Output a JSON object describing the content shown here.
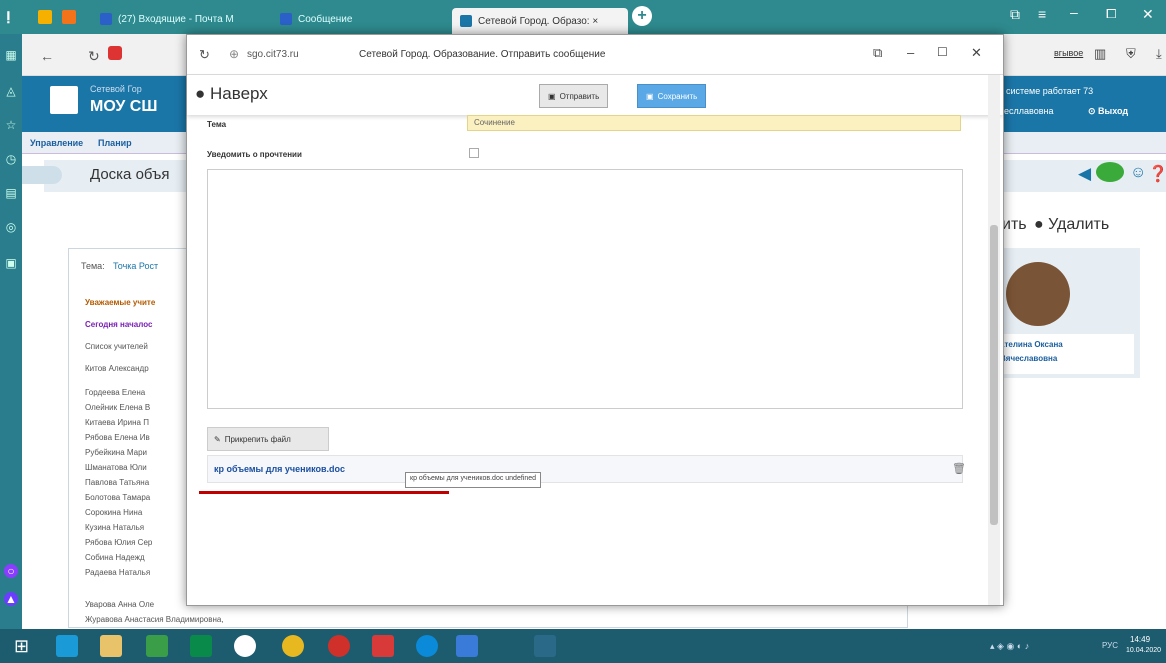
{
  "os_tabs": [
    {
      "label": "(27) Входящие - Почта M"
    },
    {
      "label": "Сообщение"
    },
    {
      "label": "Сетевой Город. Образо: ×"
    }
  ],
  "addressbar": {
    "url": "sgo.cit73.ru",
    "page_title": "Сетевой Город. Образование. Отправить сообщение",
    "right_text": "вгывое"
  },
  "site": {
    "brand_line1": "Сетевой Гор",
    "brand_line2": "МОУ СШ",
    "right_line1": "системе работает 73",
    "right_line2": "есллавовна",
    "logout": "Выход",
    "nav": [
      "Управление",
      "Планир"
    ],
    "board_title": "Доска объя",
    "delete_text": "ить",
    "delete_label": "Удалить",
    "subject_label": "Тема:",
    "subject_value": "Точка Рост",
    "teacher_line1": "ателина Оксана",
    "teacher_line2": "Вячеславовна",
    "rows": [
      "Уважаемые учите",
      "Сегодня началос",
      "Список учителей",
      "Китов Александр",
      "Гордеева Елена",
      "Олейник Елена В",
      "Китаева Ирина П",
      "Рябова Елена Ив",
      "Рубейкина Мари",
      "Шманатова Юли",
      "Павлова Татьяна",
      "Болотова Тамара",
      "Сорокина Нина",
      "Кузина Наталья",
      "Рябова Юлия Сер",
      "Собина Надежд",
      "Радаева Наталья",
      "Уварова Анна Оле",
      "Журавова Анастасия Владимировна,"
    ]
  },
  "popup": {
    "url": "sgo.cit73.ru",
    "title": "Сетевой Город. Образование. Отправить сообщение",
    "back_label": "Наверх",
    "send_label": "Отправить",
    "save_label": "Сохранить",
    "field_subject_label": "Тема",
    "field_subject_value": "Сочинение",
    "notify_label": "Уведомить о прочтении",
    "attach_label": "Прикрепить файл",
    "file_name": "кр объемы для учеников.doc",
    "tooltip": "кр объемы для учеников.doc undefined"
  },
  "taskbar": {
    "time": "14:49",
    "date": "10.04.2020",
    "lang": "РУС"
  },
  "colors": {
    "teal": "#2e8a8e",
    "site_blue": "#1b76a8",
    "subject_bg": "#fbf0c0",
    "underline_red": "#c00000",
    "save_btn": "#5aa9e6"
  }
}
